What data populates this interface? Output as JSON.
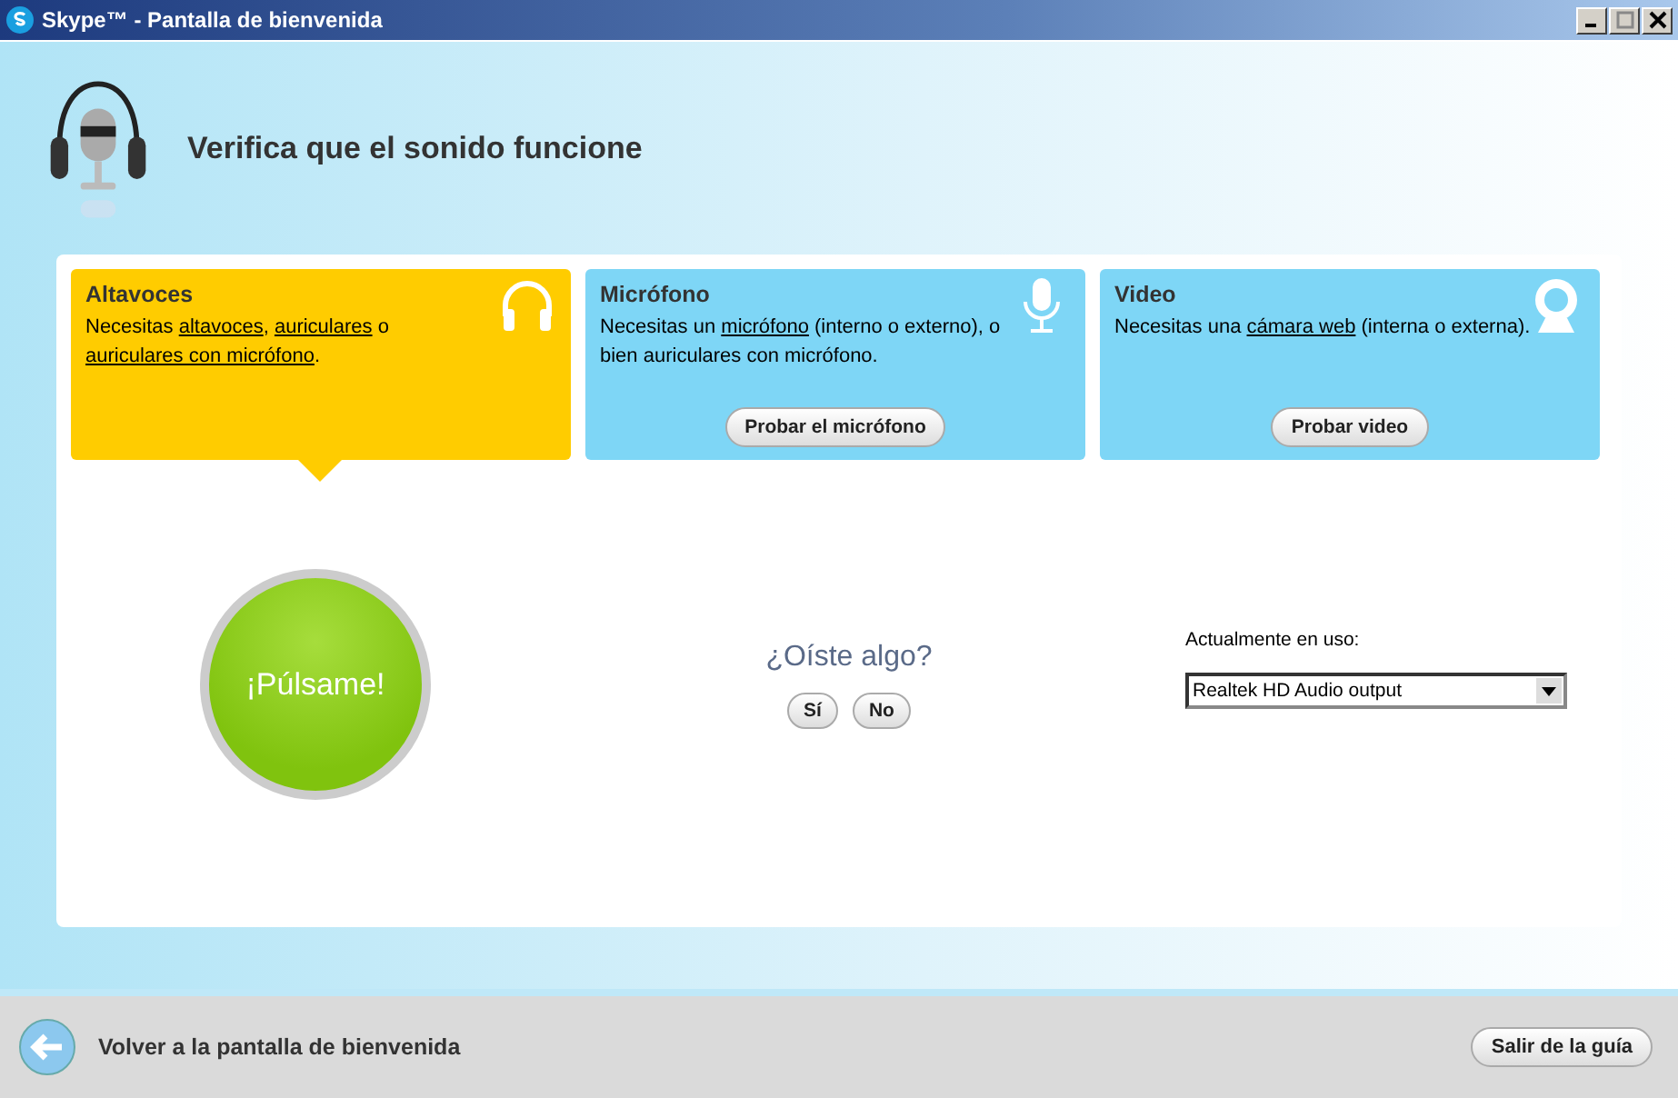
{
  "window": {
    "title": "Skype™ - Pantalla de bienvenida"
  },
  "heading": "Verifica que el sonido funcione",
  "cards": [
    {
      "kind": "speakers",
      "title": "Altavoces",
      "selected": true,
      "description": [
        {
          "text": "Necesitas ",
          "link": false
        },
        {
          "text": "altavoces",
          "link": true
        },
        {
          "text": ", ",
          "link": false
        },
        {
          "text": "auriculares",
          "link": true
        },
        {
          "text": " o ",
          "link": false
        },
        {
          "text": "auriculares con micrófono",
          "link": true
        },
        {
          "text": ".",
          "link": false
        }
      ]
    },
    {
      "kind": "microphone",
      "title": "Micrófono",
      "selected": false,
      "description": [
        {
          "text": "Necesitas un ",
          "link": false
        },
        {
          "text": "micrófono",
          "link": true
        },
        {
          "text": " (interno o externo), o bien auriculares con micrófono.",
          "link": false
        }
      ],
      "button": "Probar el micrófono"
    },
    {
      "kind": "webcam",
      "title": "Video",
      "selected": false,
      "description": [
        {
          "text": "Necesitas una ",
          "link": false
        },
        {
          "text": "cámara web",
          "link": true
        },
        {
          "text": " (interna o externa).",
          "link": false
        }
      ],
      "button": "Probar video"
    }
  ],
  "play_button": "¡Púlsame!",
  "question": "¿Oíste algo?",
  "answers": [
    "Sí",
    "No"
  ],
  "device": {
    "label": "Actualmente en uso:",
    "value": "Realtek HD Audio output"
  },
  "footer": {
    "back": "Volver a la pantalla de bienvenida",
    "exit": "Salir de la guía"
  }
}
